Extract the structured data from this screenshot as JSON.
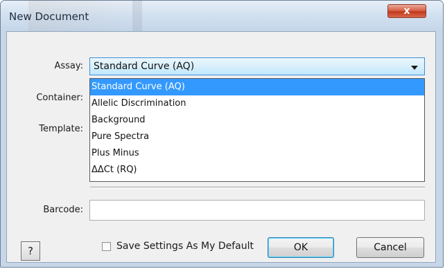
{
  "window": {
    "title": "New Document",
    "close_glyph": "x"
  },
  "form": {
    "assay_label": "Assay:",
    "assay_value": "Standard Curve (AQ)",
    "container_label": "Container:",
    "template_label": "Template:",
    "barcode_label": "Barcode:",
    "barcode_value": ""
  },
  "assay_options": [
    "Standard Curve (AQ)",
    "Allelic Discrimination",
    "Background",
    "Pure Spectra",
    "Plus Minus",
    "ΔΔCt (RQ)"
  ],
  "assay_selected_index": 0,
  "footer": {
    "help_label": "?",
    "save_default_label": "Save Settings As My Default",
    "save_default_checked": false,
    "ok_label": "OK",
    "cancel_label": "Cancel"
  },
  "icons": {
    "close": "close-icon",
    "dropdown": "chevron-down-icon",
    "help": "help-icon"
  },
  "colors": {
    "selection": "#3399ff",
    "close_button": "#c0391d",
    "title_bar": "#d3e1f0"
  }
}
